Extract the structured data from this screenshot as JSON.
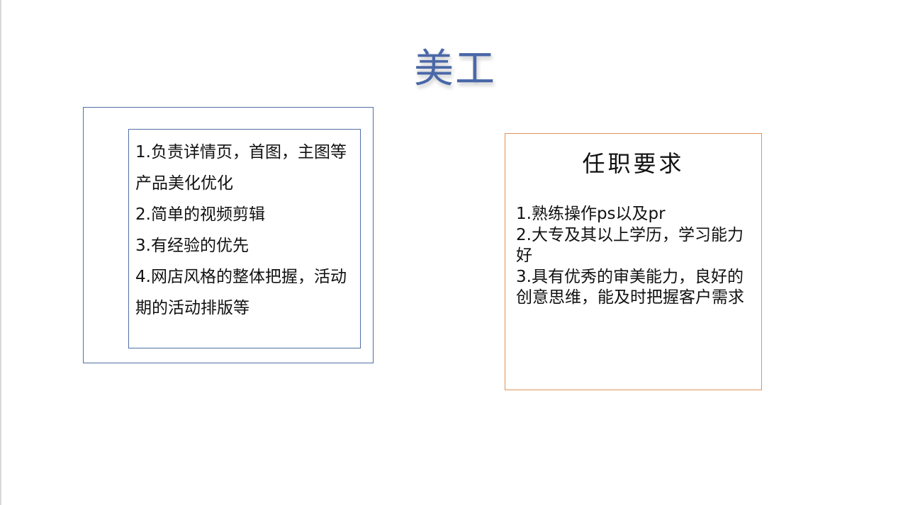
{
  "slide": {
    "title": "美工",
    "duties": {
      "items": [
        "1.负责详情页，首图，主图等",
        "产品美化优化",
        "2.简单的视频剪辑",
        "3.有经验的优先",
        "4.网店风格的整体把握，活动期的活动排版等"
      ]
    },
    "requirements": {
      "heading": "任职要求",
      "items": [
        "1.熟练操作ps以及pr",
        "2.大专及其以上学历，学习能力好",
        "3.具有优秀的审美能力，良好的创意思维，能及时把握客户需求"
      ]
    }
  },
  "colors": {
    "title": "#4a68a8",
    "duties_border": "#4f6fa6",
    "requirements_border": "#e0925a",
    "text": "#111111"
  }
}
